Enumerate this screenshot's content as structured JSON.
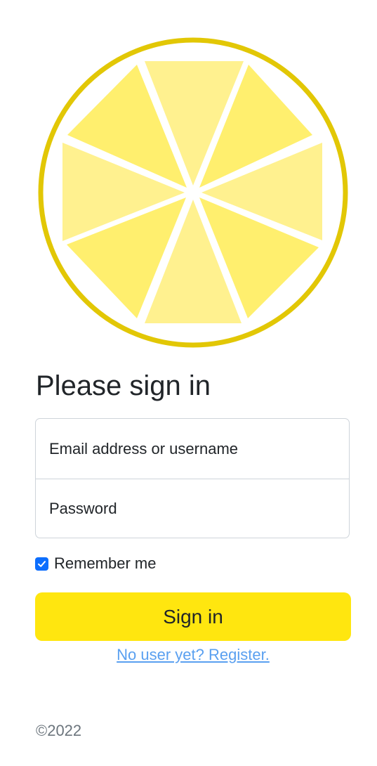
{
  "logo": {
    "icon": "lemon-slice-icon",
    "rim_color": "#e2c705",
    "segment_color_light": "#fff18f",
    "segment_color_dark": "#ffef6e"
  },
  "form": {
    "title": "Please sign in",
    "email_placeholder": "Email address or username",
    "password_placeholder": "Password",
    "remember_label": "Remember me",
    "remember_checked": true,
    "submit_label": "Sign in",
    "register_link": "No user yet? Register."
  },
  "colors": {
    "button": "#ffe60f",
    "link": "#5aa0f0",
    "checkbox": "#0d6efd"
  },
  "footer": {
    "copyright": "©2022"
  }
}
